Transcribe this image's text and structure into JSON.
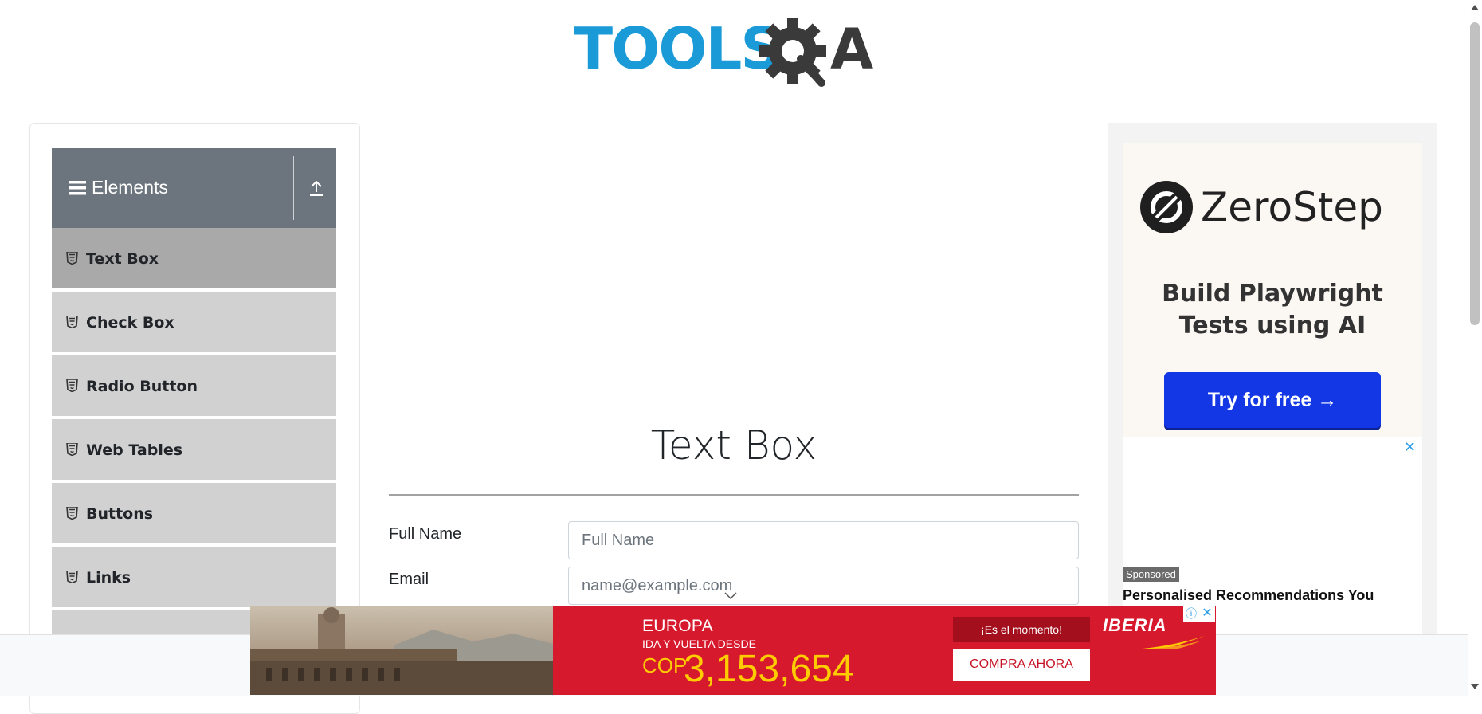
{
  "header": {
    "logo_text_part1": "TOOLS",
    "logo_text_part2": "A"
  },
  "sidebar": {
    "group_title": "Elements",
    "items": [
      {
        "label": "Text Box",
        "active": true
      },
      {
        "label": "Check Box",
        "active": false
      },
      {
        "label": "Radio Button",
        "active": false
      },
      {
        "label": "Web Tables",
        "active": false
      },
      {
        "label": "Buttons",
        "active": false
      },
      {
        "label": "Links",
        "active": false
      }
    ]
  },
  "main": {
    "title": "Text Box",
    "form": {
      "full_name_label": "Full Name",
      "full_name_placeholder": "Full Name",
      "email_label": "Email",
      "email_placeholder": "name@example.com"
    }
  },
  "ad_right": {
    "brand": "ZeroStep",
    "tagline_line1": "Build Playwright",
    "tagline_line2": "Tests using AI",
    "cta": "Try for free →",
    "close": "✕",
    "sponsored": "Sponsored",
    "recommendation": "Personalised Recommendations You"
  },
  "banner": {
    "destination": "EUROPA",
    "subtitle": "IDA Y VUELTA DESDE",
    "currency": "COP",
    "price": "3,153,654",
    "moment": "¡Es el momento!",
    "buy": "COMPRA AHORA",
    "brand": "IBERIA",
    "info": "ⓘ",
    "close": "✕"
  },
  "colors": {
    "sidebar_header": "#6c757d",
    "sidebar_item": "#d1d1d1",
    "sidebar_item_active": "#a9a9a9",
    "logo_blue": "#1a9bd7",
    "logo_dark": "#3a3a3a",
    "cta_blue": "#1437e6",
    "banner_red": "#d7192d",
    "banner_yellow": "#ffcc00"
  }
}
